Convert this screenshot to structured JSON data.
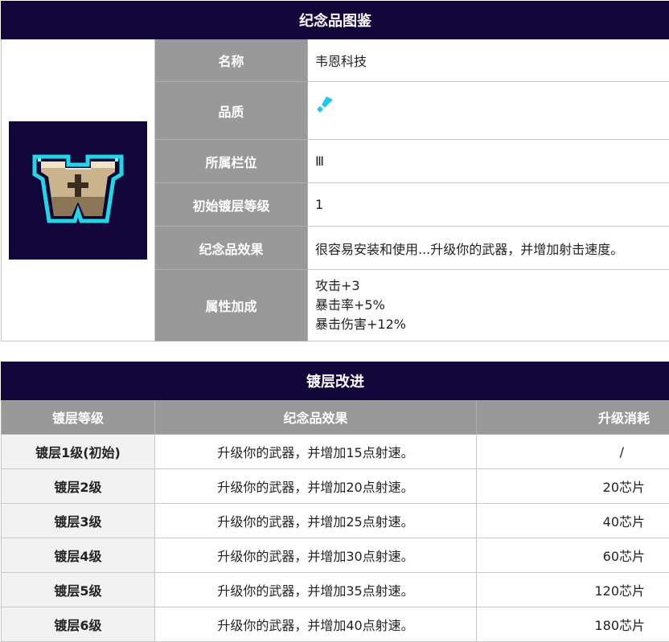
{
  "info_table": {
    "title": "纪念品图鉴",
    "icon_name": "wayne-tech-w-emblem-icon",
    "rows": [
      {
        "label": "名称",
        "value": "韦恩科技"
      },
      {
        "label": "品质",
        "value_icon": "blue-quality-gem-icon",
        "quality_color": "#1ec8e8"
      },
      {
        "label": "所属栏位",
        "value": "Ⅲ"
      },
      {
        "label": "初始镀层等级",
        "value": "1"
      },
      {
        "label": "纪念品效果",
        "value": "很容易安装和使用...升级你的武器，并增加射击速度。"
      },
      {
        "label": "属性加成",
        "values": [
          "攻击+3",
          "暴击率+5%",
          "暴击伤害+12%"
        ]
      }
    ]
  },
  "upgrade_table": {
    "title": "镀层改进",
    "headers": [
      "镀层等级",
      "纪念品效果",
      "升级消耗"
    ],
    "rows": [
      {
        "level": "镀层1级(初始)",
        "effect": "升级你的武器，并增加15点射速。",
        "cost": "/"
      },
      {
        "level": "镀层2级",
        "effect": "升级你的武器，并增加20点射速。",
        "cost": "20芯片"
      },
      {
        "level": "镀层3级",
        "effect": "升级你的武器，并增加25点射速。",
        "cost": "40芯片"
      },
      {
        "level": "镀层4级",
        "effect": "升级你的武器，并增加30点射速。",
        "cost": "60芯片"
      },
      {
        "level": "镀层5级",
        "effect": "升级你的武器，并增加35点射速。",
        "cost": "120芯片"
      },
      {
        "level": "镀层6级",
        "effect": "升级你的武器，并增加40点射速。",
        "cost": "180芯片"
      }
    ]
  },
  "colors": {
    "header_dark": "#12053a",
    "label_gray": "#999999",
    "level_bg": "#f2f2f2"
  }
}
